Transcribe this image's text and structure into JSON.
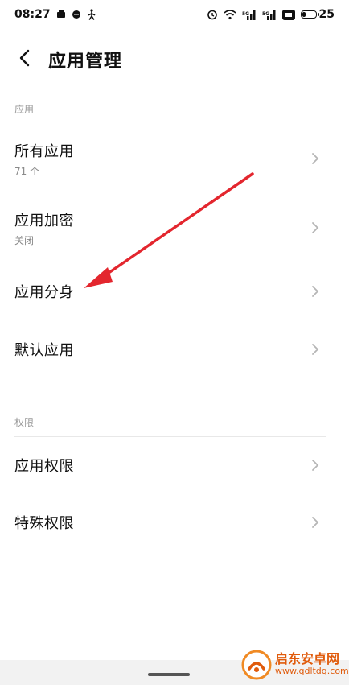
{
  "status_bar": {
    "time": "08:27",
    "battery_level": "25",
    "icons": [
      "message-icon",
      "chat-icon",
      "walk-icon",
      "alarm-icon",
      "wifi-icon",
      "signal-1-icon",
      "signal-2-icon",
      "volte-icon",
      "battery-icon"
    ]
  },
  "header": {
    "back_icon": "chevron-left-icon",
    "title": "应用管理"
  },
  "sections": {
    "apps": {
      "label": "应用",
      "items": [
        {
          "title": "所有应用",
          "subtitle": "71 个"
        },
        {
          "title": "应用加密",
          "subtitle": "关闭"
        },
        {
          "title": "应用分身",
          "subtitle": ""
        },
        {
          "title": "默认应用",
          "subtitle": ""
        }
      ]
    },
    "permissions": {
      "label": "权限",
      "items": [
        {
          "title": "应用权限",
          "subtitle": ""
        },
        {
          "title": "特殊权限",
          "subtitle": ""
        }
      ]
    }
  },
  "annotation": {
    "color": "#e3262e"
  },
  "watermark": {
    "title": "启东安卓网",
    "url": "www.qdltdq.com",
    "color": "#e05b0c"
  }
}
